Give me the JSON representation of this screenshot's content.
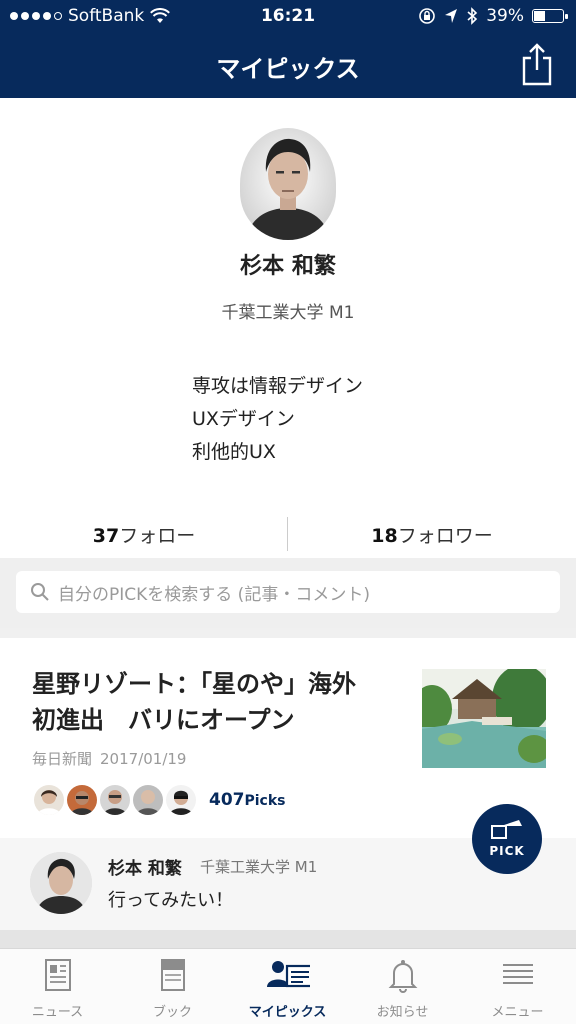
{
  "status_bar": {
    "carrier": "SoftBank",
    "time": "16:21",
    "battery": "39%"
  },
  "navbar": {
    "title": "マイピックス",
    "share_icon": "share-icon"
  },
  "profile": {
    "name": "杉本 和繁",
    "affiliation": "千葉工業大学 M1",
    "bio": [
      "専攻は情報デザイン",
      "UXデザイン",
      "利他的UX"
    ],
    "follow_count": "37",
    "follow_label": "フォロー",
    "follower_count": "18",
    "follower_label": "フォロワー"
  },
  "search": {
    "placeholder": "自分のPICKを検索する (記事・コメント)"
  },
  "article": {
    "title_line1": "星野リゾート：「星のや」海外",
    "title_line2": "初進出　バリにオープン",
    "source": "毎日新聞",
    "date": "2017/01/19",
    "picks_count": "407",
    "picks_unit": "Picks"
  },
  "comment": {
    "name": "杉本 和繁",
    "affiliation": "千葉工業大学 M1",
    "text": "行ってみたい！"
  },
  "pick_button": {
    "label": "PICK"
  },
  "tabs": [
    {
      "label": "ニュース",
      "icon": "newspaper-icon",
      "active": false
    },
    {
      "label": "ブック",
      "icon": "book-icon",
      "active": false
    },
    {
      "label": "マイピックス",
      "icon": "mypicks-icon",
      "active": true
    },
    {
      "label": "お知らせ",
      "icon": "bell-icon",
      "active": false
    },
    {
      "label": "メニュー",
      "icon": "menu-icon",
      "active": false
    }
  ],
  "colors": {
    "brand_navy": "#072a5c",
    "tab_inactive": "#8c8c8c"
  }
}
